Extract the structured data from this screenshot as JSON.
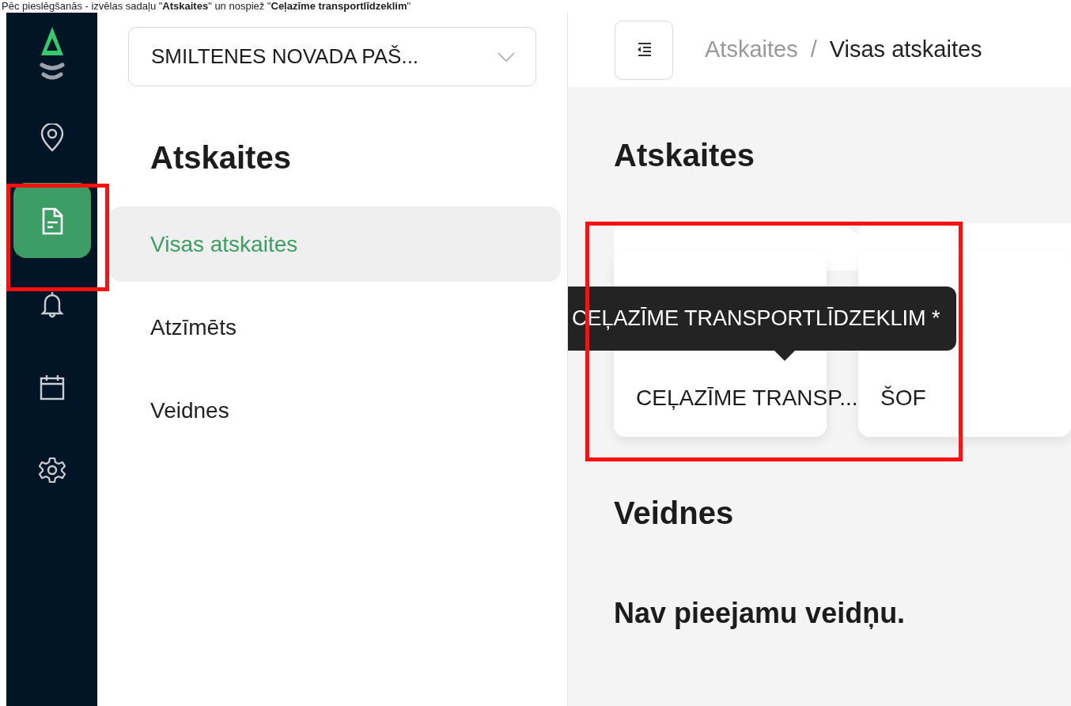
{
  "caption": "Pēc pieslēgšanās - izvēlas sadaļu \"**Atskaites**\" un nospiež \"**Ceļazīme transportlīdzeklim**\"",
  "rail": {
    "items": [
      {
        "kind": "pin",
        "selected": false
      },
      {
        "kind": "report",
        "selected": true
      },
      {
        "kind": "bell",
        "selected": false
      },
      {
        "kind": "calendar",
        "selected": false
      },
      {
        "kind": "gear",
        "selected": false
      }
    ]
  },
  "panel": {
    "org_select": {
      "value": "SMILTENES NOVADA PAŠ..."
    },
    "title": "Atskaites",
    "menu": [
      {
        "label": "Visas atskaites",
        "selected": true
      },
      {
        "label": "Atzīmēts",
        "selected": false
      },
      {
        "label": "Veidnes",
        "selected": false
      }
    ]
  },
  "breadcrumb": [
    {
      "label": "Atskaites"
    },
    {
      "label": "/"
    },
    {
      "label": "Visas atskaites"
    }
  ],
  "main": {
    "title": "Atskaites",
    "reports": [
      {
        "label": "CEĻAZĪME TRANSP..."
      },
      {
        "label": "ŠOF"
      }
    ],
    "tooltip": "CEĻAZĪME TRANSPORTLĪDZEKLIM *",
    "templates_title": "Veidnes",
    "templates_empty": "Nav pieejamu veidņu."
  }
}
